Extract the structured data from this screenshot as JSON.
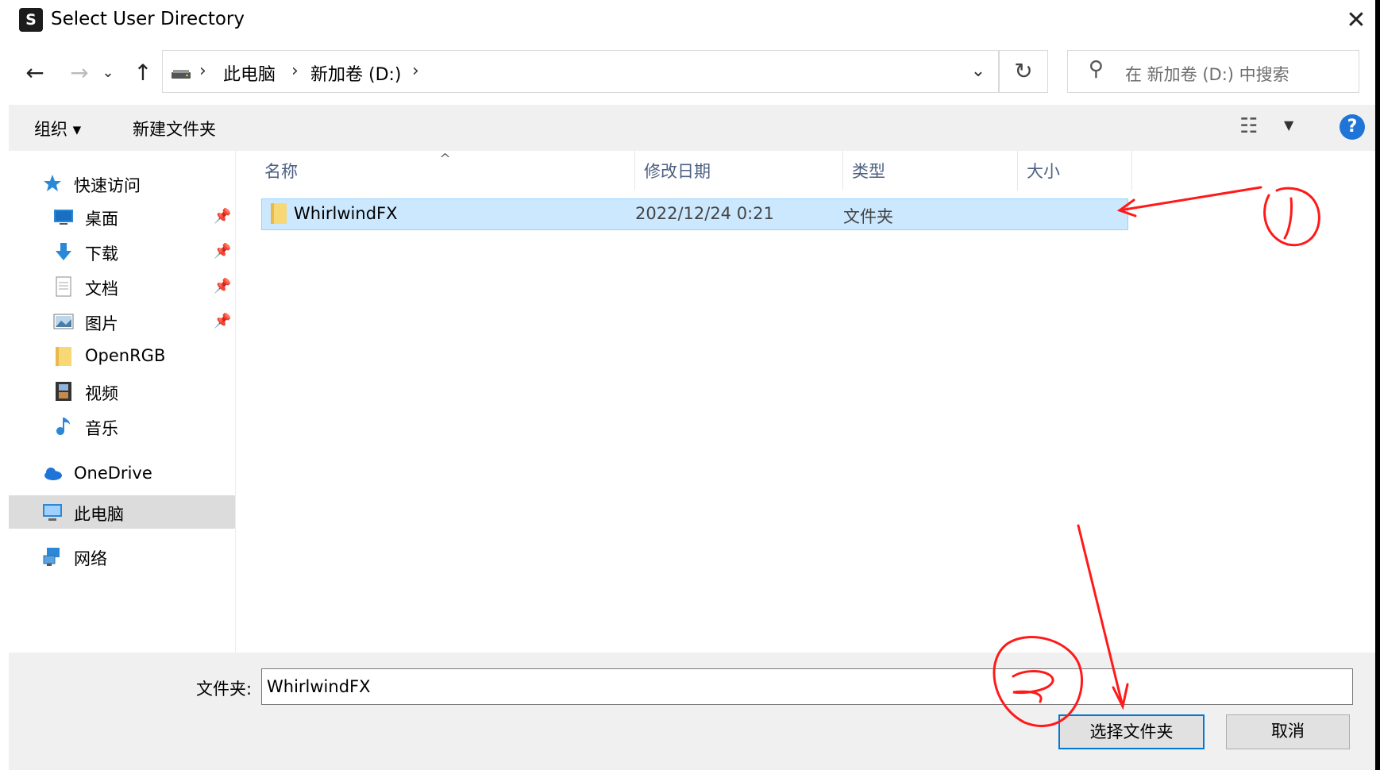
{
  "title_bar": {
    "app_icon_text": "S",
    "title": "Select User Directory",
    "close_symbol": "✕"
  },
  "nav": {
    "back_symbol": "←",
    "forward_symbol": "→",
    "recent_symbol": "⌄",
    "up_symbol": "↑",
    "breadcrumb": [
      "此电脑",
      "新加卷 (D:)"
    ],
    "breadcrumb_sep": "›",
    "address_dropdown_symbol": "⌄",
    "refresh_symbol": "↻",
    "search_placeholder": "在 新加卷 (D:) 中搜索"
  },
  "commands": {
    "organize": "组织 ▾",
    "new_folder": "新建文件夹",
    "help": "?"
  },
  "sidebar": {
    "quick_access": "快速访问",
    "items": [
      {
        "label": "桌面",
        "icon": "desktop-icon",
        "pinned": true
      },
      {
        "label": "下载",
        "icon": "download-icon",
        "pinned": true
      },
      {
        "label": "文档",
        "icon": "document-icon",
        "pinned": true
      },
      {
        "label": "图片",
        "icon": "pictures-icon",
        "pinned": true
      },
      {
        "label": "OpenRGB",
        "icon": "folder-icon",
        "pinned": false
      },
      {
        "label": "视频",
        "icon": "video-icon",
        "pinned": false
      },
      {
        "label": "音乐",
        "icon": "music-icon",
        "pinned": false
      }
    ],
    "onedrive": "OneDrive",
    "this_pc": "此电脑",
    "network": "网络"
  },
  "columns": {
    "name": "名称",
    "date": "修改日期",
    "type": "类型",
    "size": "大小"
  },
  "files": [
    {
      "name": "WhirlwindFX",
      "date": "2022/12/24 0:21",
      "type": "文件夹",
      "size": "",
      "selected": true
    }
  ],
  "footer": {
    "folder_label": "文件夹:",
    "folder_value": "WhirlwindFX",
    "select_button": "选择文件夹",
    "cancel_button": "取消"
  },
  "colors": {
    "selection": "#cce8ff",
    "accent": "#0078d7",
    "annotation": "#ff1a1a"
  }
}
